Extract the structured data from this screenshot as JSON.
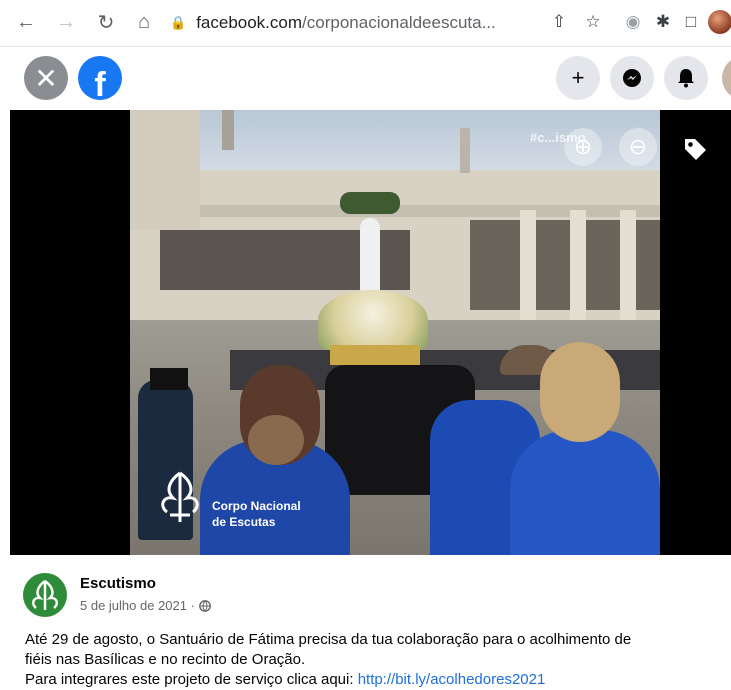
{
  "browser": {
    "url_domain": "facebook.com",
    "url_path": "/corponacionaldeescuta..."
  },
  "icons": {
    "back": "arrow-left-icon",
    "forward": "arrow-right-icon",
    "reload": "reload-icon",
    "home": "home-icon",
    "lock": "lock-icon",
    "share": "share-icon",
    "star": "star-icon",
    "extensions": "puzzle-icon",
    "sidebar": "sidebar-icon",
    "close": "close-icon",
    "create": "plus-icon",
    "messenger": "messenger-icon",
    "notifications": "bell-icon",
    "zoom_in": "zoom-in-icon",
    "zoom_out": "zoom-out-icon",
    "tag": "tag-icon",
    "audience": "globe-icon"
  },
  "photo": {
    "watermark": "#c...ismo",
    "logo_line1": "Corpo Nacional",
    "logo_line2": "de Escutas"
  },
  "post": {
    "author": "Escutismo",
    "date": "5 de julho de 2021 ·",
    "line1": "Até 29 de agosto, o Santuário de Fátima precisa da tua colaboração para o acolhimento de",
    "line2": "fiéis nas Basílicas e no recinto de Oração.",
    "line3_prefix": "Para integrares este projeto de serviço clica aqui: ",
    "link": "http://bit.ly/acolhedores2021"
  },
  "colors": {
    "fb_blue": "#1877f2",
    "link": "#216fdb",
    "brand_green": "#2e8b3a"
  }
}
